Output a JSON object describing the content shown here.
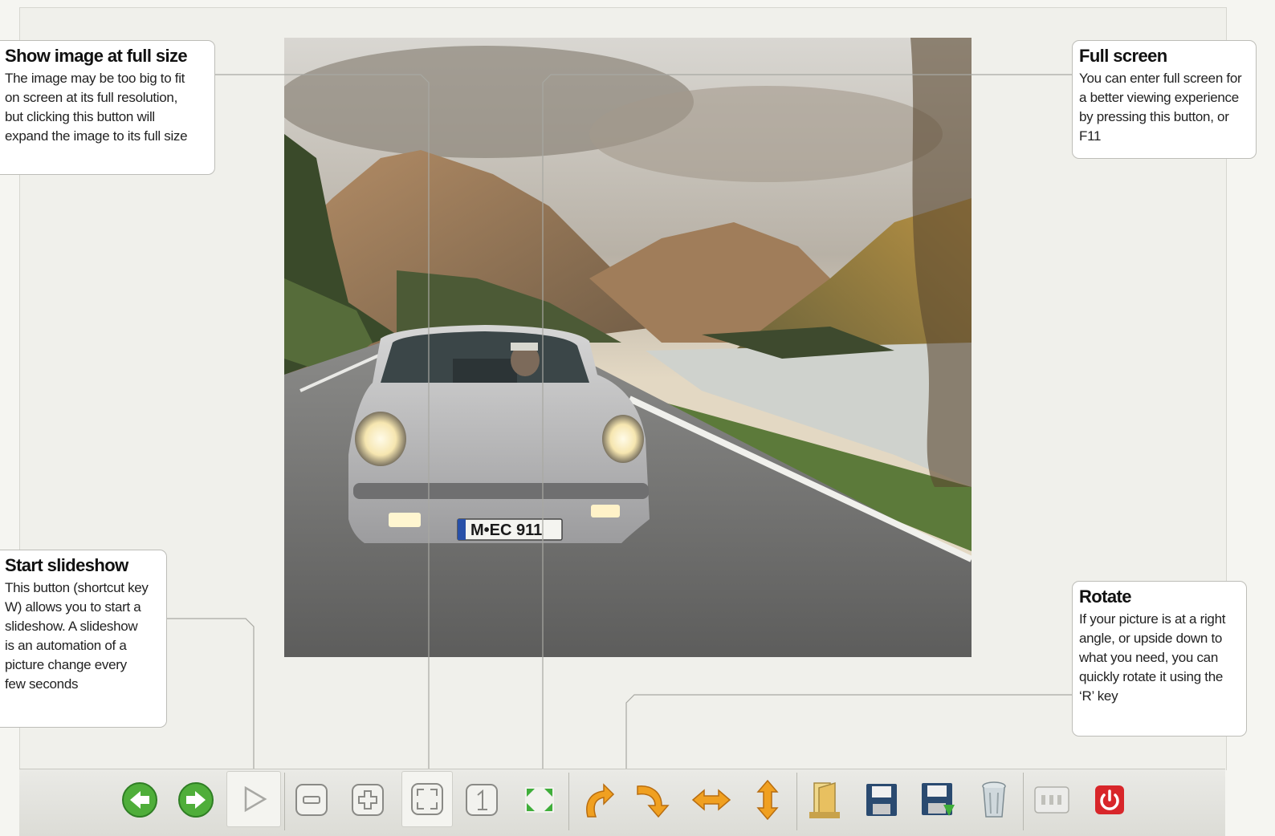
{
  "callouts": {
    "fullsize": {
      "title": "Show image at full size",
      "body": "The image may be too big to fit on screen at its full resolution, but clicking this button will expand the image to its full size"
    },
    "fullscreen": {
      "title": "Full screen",
      "body": "You can enter full screen for a better viewing experience by pressing this button, or F11"
    },
    "slideshow": {
      "title": "Start slideshow",
      "body": "This button (shortcut key W) allows you to start a slideshow. A slideshow is an automation of a picture change every few seconds"
    },
    "rotate": {
      "title": "Rotate",
      "body": "If your picture is at a right angle, or upside down to what you need, you can quickly rotate it using the ‘R’ key"
    }
  },
  "photo": {
    "license_plate": "M•EC 911"
  },
  "toolbar": {
    "buttons": [
      {
        "icon": "previous-arrow-icon",
        "color": "#4fae3a"
      },
      {
        "icon": "next-arrow-icon",
        "color": "#4fae3a"
      },
      {
        "icon": "slideshow-play-icon",
        "color": "#b8b8b4"
      },
      {
        "icon": "zoom-out-icon",
        "color": "#8a8a86"
      },
      {
        "icon": "zoom-in-icon",
        "color": "#8a8a86"
      },
      {
        "icon": "fit-to-window-icon",
        "color": "#8a8a86"
      },
      {
        "icon": "actual-size-icon",
        "color": "#8a8a86"
      },
      {
        "icon": "full-screen-icon",
        "color": "#3fae3a"
      },
      {
        "icon": "rotate-left-icon",
        "color": "#f0a020"
      },
      {
        "icon": "rotate-right-icon",
        "color": "#f0a020"
      },
      {
        "icon": "flip-horizontal-icon",
        "color": "#f0a020"
      },
      {
        "icon": "flip-vertical-icon",
        "color": "#f0a020"
      },
      {
        "icon": "open-folder-icon",
        "color": "#e8c060"
      },
      {
        "icon": "save-icon",
        "color": "#2a4a70"
      },
      {
        "icon": "save-as-icon",
        "color": "#2a4a70"
      },
      {
        "icon": "delete-icon",
        "color": "#8a9aa0"
      },
      {
        "icon": "settings-icon",
        "color": "#b0b0aa"
      },
      {
        "icon": "close-power-icon",
        "color": "#d8262a"
      }
    ]
  }
}
